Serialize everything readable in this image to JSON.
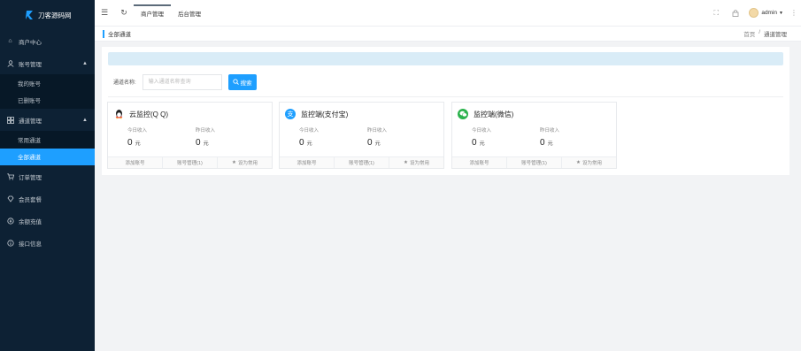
{
  "sidebar": {
    "logo_text": "刀客源码网",
    "menu": [
      {
        "label": "商户中心",
        "icon": "home-icon"
      },
      {
        "label": "账号管理",
        "icon": "user-icon",
        "expanded": true,
        "children": [
          "我的账号",
          "已删账号"
        ]
      },
      {
        "label": "通道管理",
        "icon": "grid-icon",
        "expanded": true,
        "children": [
          "常用通道",
          "全部通道"
        ]
      },
      {
        "label": "订单管理",
        "icon": "cart-icon"
      },
      {
        "label": "会员套餐",
        "icon": "diamond-icon"
      },
      {
        "label": "余额充值",
        "icon": "wallet-icon"
      },
      {
        "label": "接口信息",
        "icon": "info-icon"
      }
    ],
    "active_item": "全部通道"
  },
  "topbar": {
    "tabs": [
      "商户管理",
      "后台管理"
    ],
    "active_tab": "商户管理",
    "username": "admin"
  },
  "breadcrumb": {
    "page_label": "全部通道",
    "path": [
      "首页",
      "/",
      "通道管理"
    ]
  },
  "search": {
    "label": "通道名称:",
    "placeholder": "输入通道名称查询",
    "button_label": "搜索"
  },
  "cards": [
    {
      "title": "云监控(Q Q)",
      "icon": "qq-icon",
      "icon_color": "#222222",
      "today_label": "今日收入",
      "today_value": "0",
      "yesterday_label": "昨日收入",
      "yesterday_value": "0",
      "unit": "元",
      "actions": [
        "添加账号",
        "账号管理(1)",
        "设为常用"
      ]
    },
    {
      "title": "监控端(支付宝)",
      "icon": "alipay-icon",
      "icon_color": "#1e9fff",
      "today_label": "今日收入",
      "today_value": "0",
      "yesterday_label": "昨日收入",
      "yesterday_value": "0",
      "unit": "元",
      "actions": [
        "添加账号",
        "账号管理(1)",
        "设为常用"
      ]
    },
    {
      "title": "监控端(微信)",
      "icon": "wechat-icon",
      "icon_color": "#2bb24c",
      "today_label": "今日收入",
      "today_value": "0",
      "yesterday_label": "昨日收入",
      "yesterday_value": "0",
      "unit": "元",
      "actions": [
        "添加账号",
        "账号管理(1)",
        "设为常用"
      ]
    }
  ]
}
